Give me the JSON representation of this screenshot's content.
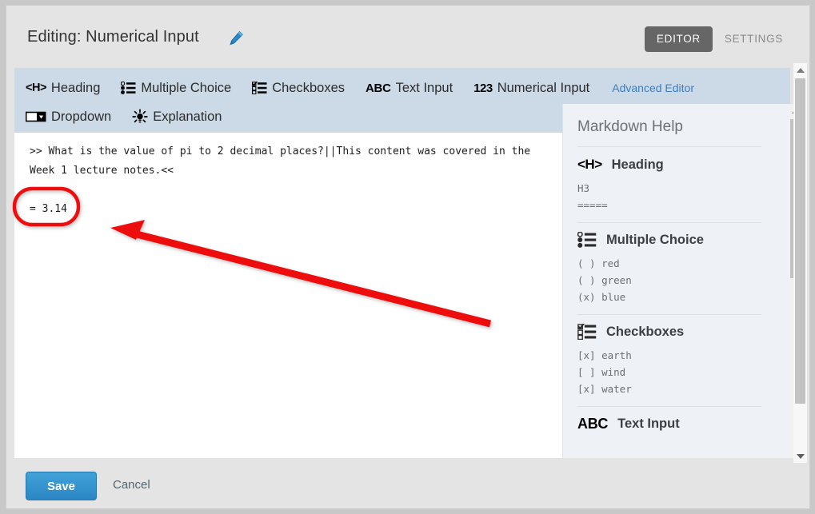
{
  "header": {
    "title": "Editing: Numerical Input",
    "edit_icon": "pencil-icon",
    "view_toggle": {
      "editor_label": "EDITOR",
      "settings_label": "SETTINGS",
      "active": "EDITOR"
    }
  },
  "toolbar": {
    "items": [
      {
        "icon": "heading-icon",
        "glyph": "<H>",
        "label": "Heading"
      },
      {
        "icon": "multiple-choice-icon",
        "glyph": "",
        "label": "Multiple Choice"
      },
      {
        "icon": "checkboxes-icon",
        "glyph": "",
        "label": "Checkboxes"
      },
      {
        "icon": "text-input-icon",
        "glyph": "ABC",
        "label": "Text Input"
      },
      {
        "icon": "numerical-input-icon",
        "glyph": "123",
        "label": "Numerical Input"
      },
      {
        "icon": "dropdown-icon",
        "glyph": "",
        "label": "Dropdown"
      },
      {
        "icon": "explanation-icon",
        "glyph": "",
        "label": "Explanation"
      }
    ],
    "advanced_editor_label": "Advanced Editor",
    "advanced_editor_color": "#3a7ebf"
  },
  "editor": {
    "question_text": ">> What is the value of pi to 2 decimal places?||This content was covered in the Week 1 lecture notes.<<",
    "answer_text": "= 3.14"
  },
  "help": {
    "title": "Markdown Help",
    "sections": [
      {
        "icon": "heading-icon",
        "glyph": "<H>",
        "title": "Heading",
        "code": "H3\n====="
      },
      {
        "icon": "multiple-choice-icon",
        "glyph": "",
        "title": "Multiple Choice",
        "code": "( ) red\n( ) green\n(x) blue"
      },
      {
        "icon": "checkboxes-icon",
        "glyph": "",
        "title": "Checkboxes",
        "code": "[x] earth\n[ ] wind\n[x] water"
      },
      {
        "icon": "text-input-icon",
        "glyph": "ABC",
        "title": "Text Input",
        "code": ""
      }
    ]
  },
  "footer": {
    "save_label": "Save",
    "cancel_label": "Cancel"
  },
  "annotation": {
    "highlight_target": "= 3.14",
    "color": "#ee1111",
    "shapes": [
      "ellipse-highlight",
      "pointer-arrow"
    ]
  },
  "colors": {
    "toolbar_bg": "#ccd9e6",
    "help_bg": "#eef1f5",
    "chrome_bg": "#e4e4e4",
    "active_toggle_bg": "#666666",
    "save_button_bg": "#2a86c4"
  }
}
